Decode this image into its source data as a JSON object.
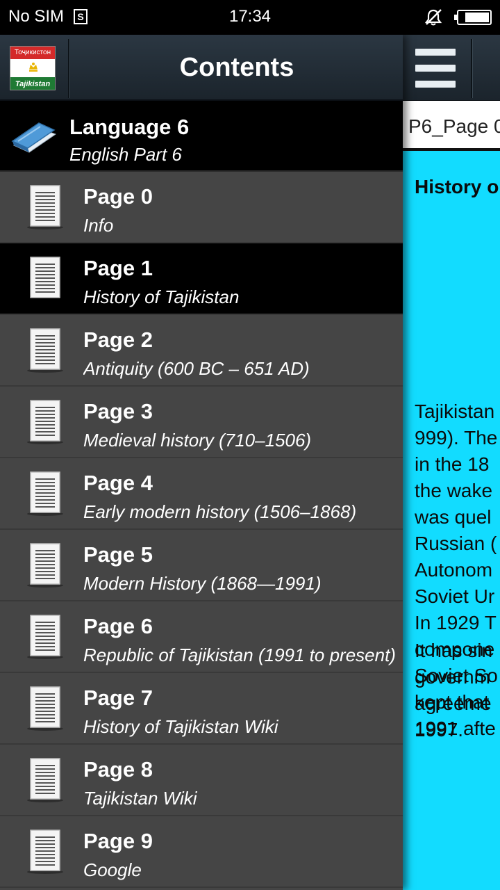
{
  "status_bar": {
    "carrier": "No SIM",
    "sim_icon": "sim-card-icon",
    "time": "17:34",
    "notification_icon": "bell-muted-icon",
    "battery_level": 0.8
  },
  "drawer": {
    "title": "Contents",
    "logo": {
      "top_text": "Тоҷикистон",
      "bottom_text": "Tajikistan"
    },
    "group": {
      "title": "Language 6",
      "subtitle": "English Part 6",
      "icon": "book-icon"
    },
    "items": [
      {
        "title": "Page 0",
        "subtitle": "Info",
        "selected": false
      },
      {
        "title": "Page 1",
        "subtitle": "History of Tajikistan",
        "selected": true
      },
      {
        "title": "Page 2",
        "subtitle": "Antiquity (600 BC – 651 AD)",
        "selected": false
      },
      {
        "title": "Page 3",
        "subtitle": "Medieval history (710–1506)",
        "selected": false
      },
      {
        "title": "Page 4",
        "subtitle": "Early modern history (1506–1868)",
        "selected": false
      },
      {
        "title": "Page 5",
        "subtitle": "Modern History (1868—1991)",
        "selected": false
      },
      {
        "title": "Page 6",
        "subtitle": "Republic of Tajikistan (1991 to present)",
        "selected": false
      },
      {
        "title": "Page 7",
        "subtitle": "History of Tajikistan Wiki",
        "selected": false
      },
      {
        "title": "Page 8",
        "subtitle": "Tajikistan Wiki",
        "selected": false
      },
      {
        "title": "Page 9",
        "subtitle": "Google",
        "selected": false
      }
    ]
  },
  "content": {
    "menu_icon": "hamburger-menu-icon",
    "tab_label": "P6_Page 0",
    "heading": "History o",
    "paragraph1_lines": [
      "Tajikistan",
      "999). The",
      "in the 18",
      "the wake",
      "was quel",
      "Russian (",
      "Autonom",
      "Soviet Ur",
      "In 1929 T",
      "compone",
      "Soviet So",
      "kept that",
      "1991 afte"
    ],
    "paragraph2_lines": [
      "It has sin",
      "governm",
      "agreeme",
      "1997."
    ]
  },
  "colors": {
    "content_bg": "#12dcff",
    "drawer_bg": "#454545",
    "selected_bg": "#000000",
    "header_bg": "#1f2a33"
  }
}
